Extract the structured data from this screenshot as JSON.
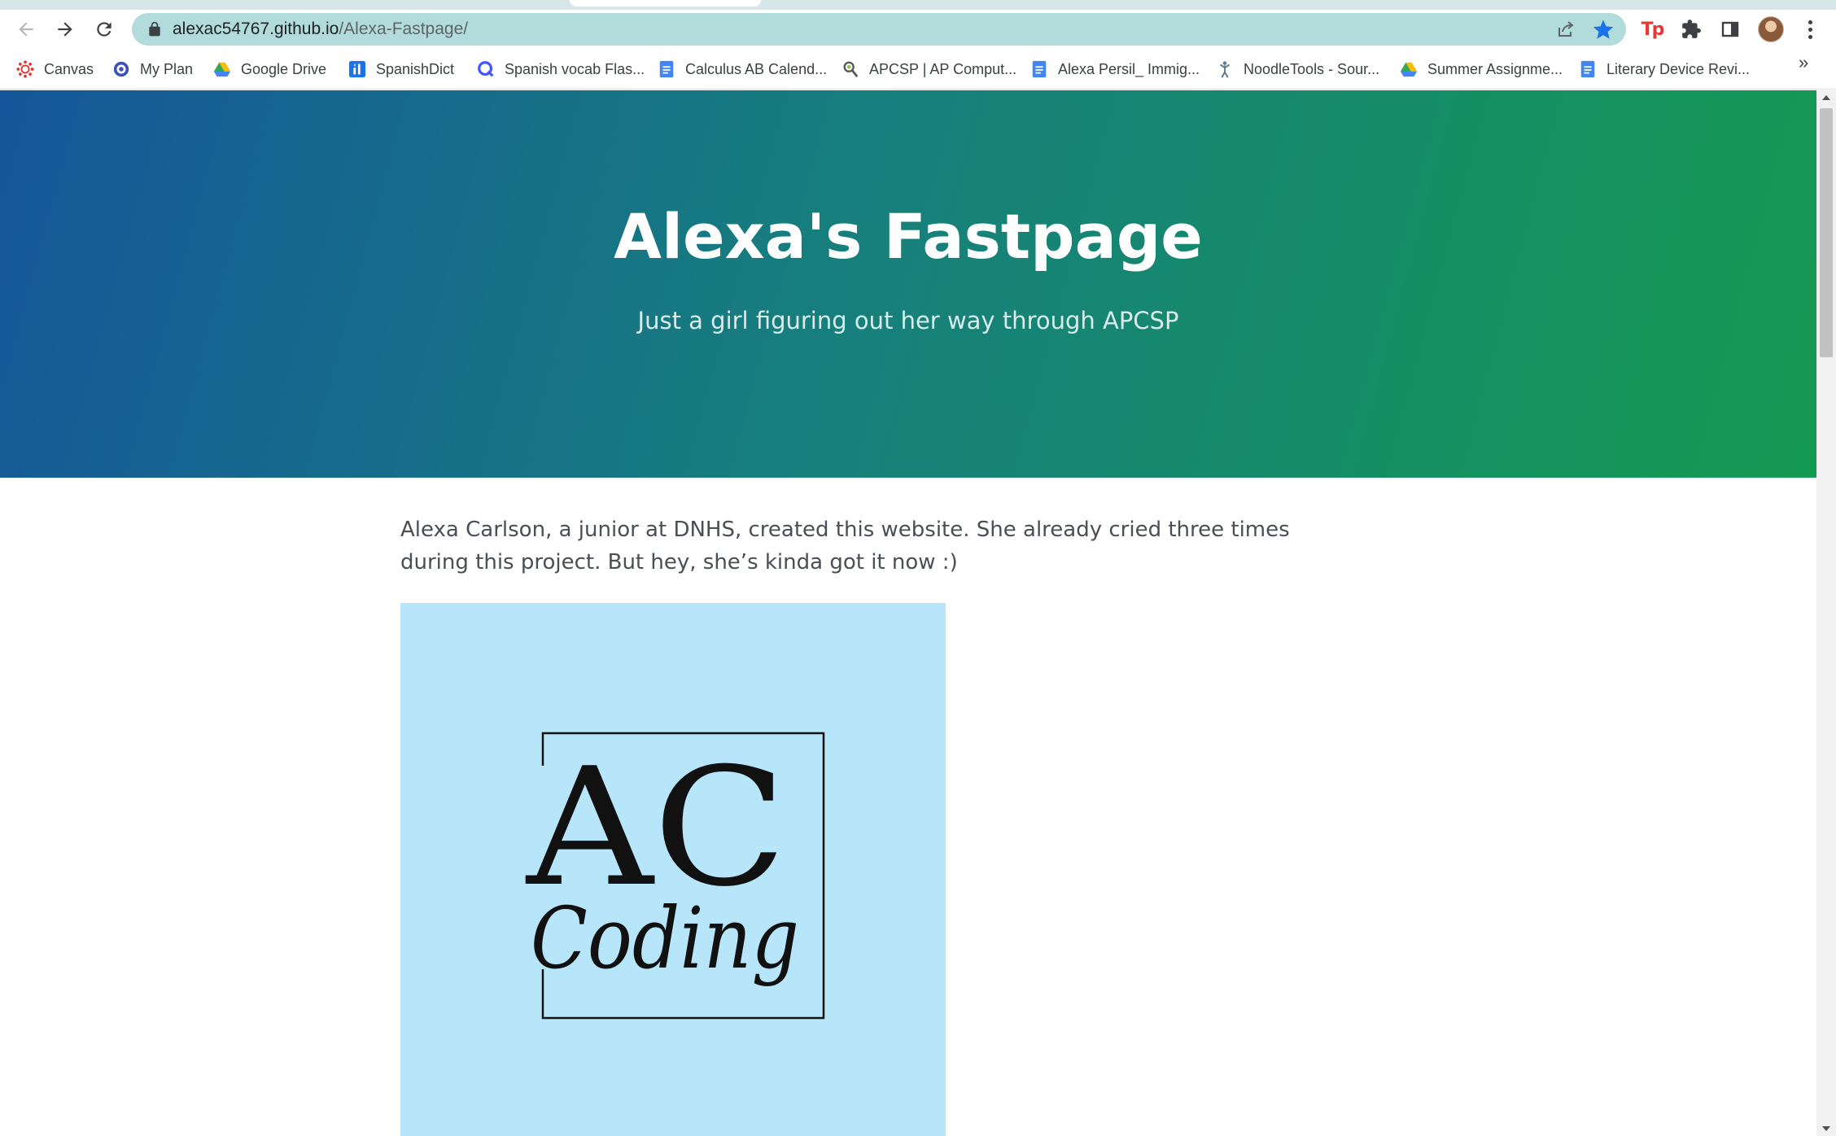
{
  "browser": {
    "url_host": "alexac54767.github.io",
    "url_path": "/Alexa-Fastpage/",
    "extension_label": "Tp",
    "more_bookmarks": "»"
  },
  "bookmarks": [
    {
      "label": "Canvas",
      "icon": "canvas-icon",
      "color": "#e4322b"
    },
    {
      "label": "My Plan",
      "icon": "myplan-icon",
      "color": "#3f51b5"
    },
    {
      "label": "Google Drive",
      "icon": "google-drive-icon",
      "color": "#34a853"
    },
    {
      "label": "SpanishDict",
      "icon": "spanishdict-icon",
      "color": "#1a73e8"
    },
    {
      "label": "Spanish vocab Flas...",
      "icon": "quizlet-icon",
      "color": "#4255ff"
    },
    {
      "label": "Calculus AB Calend...",
      "icon": "google-docs-icon",
      "color": "#4285f4"
    },
    {
      "label": "APCSP | AP Comput...",
      "icon": "apcsp-icon",
      "color": "#555555"
    },
    {
      "label": "Alexa Persil_ Immig...",
      "icon": "google-docs-icon",
      "color": "#4285f4"
    },
    {
      "label": "NoodleTools - Sour...",
      "icon": "noodletools-icon",
      "color": "#607d8b"
    },
    {
      "label": "Summer Assignme...",
      "icon": "google-drive-icon",
      "color": "#34a853"
    },
    {
      "label": "Literary Device Revi...",
      "icon": "google-docs-icon",
      "color": "#4285f4"
    }
  ],
  "page": {
    "title": "Alexa's Fastpage",
    "subtitle": "Just a girl figuring out her way through APCSP",
    "intro": "Alexa Carlson, a junior at DNHS, created this website. She already cried three times during this project. But hey, she’s kinda got it now :)",
    "logo": {
      "initials": "AC",
      "word": "Coding"
    }
  },
  "colors": {
    "hero_start": "#15579a",
    "hero_end": "#159a52",
    "logo_bg": "#b7e5fa",
    "omnibox_bg": "#b2dcdc",
    "star": "#1a73e8"
  }
}
